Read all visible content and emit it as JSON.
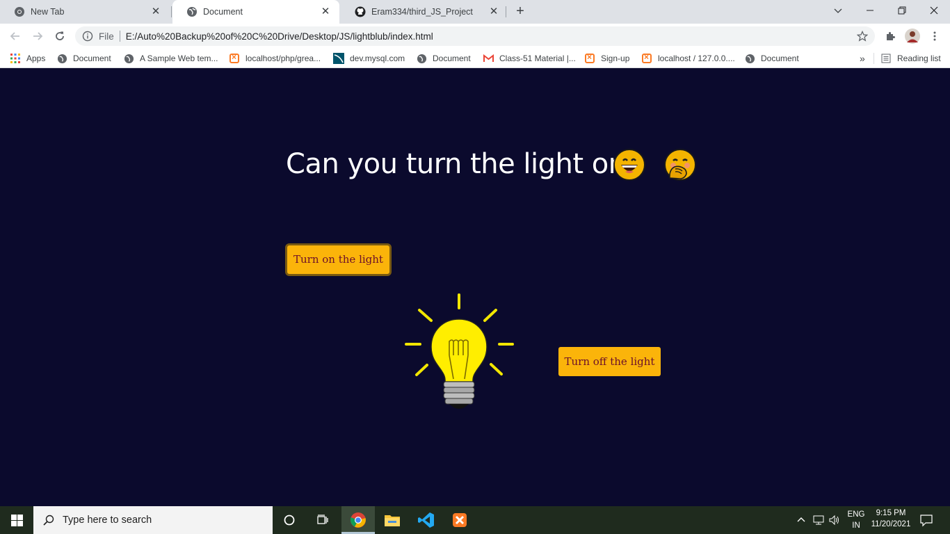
{
  "browser": {
    "tabs": [
      {
        "title": "New Tab",
        "active": false,
        "icon": "chrome-icon"
      },
      {
        "title": "Document",
        "active": true,
        "icon": "globe-icon"
      },
      {
        "title": "Eram334/third_JS_Project",
        "active": false,
        "icon": "github-icon"
      }
    ],
    "address": {
      "scheme": "File",
      "url": "E:/Auto%20Backup%20of%20C%20Drive/Desktop/JS/lightblub/index.html"
    },
    "bookmarks": [
      {
        "label": "Apps",
        "icon": "apps-grid-icon"
      },
      {
        "label": "Document",
        "icon": "globe-icon"
      },
      {
        "label": "A Sample Web tem...",
        "icon": "globe-icon"
      },
      {
        "label": "localhost/php/grea...",
        "icon": "xampp-icon"
      },
      {
        "label": "dev.mysql.com",
        "icon": "mysql-icon"
      },
      {
        "label": "Document",
        "icon": "globe-icon"
      },
      {
        "label": "Class-51 Material |...",
        "icon": "gmail-icon"
      },
      {
        "label": "Sign-up",
        "icon": "xampp-icon"
      },
      {
        "label": "localhost / 127.0.0....",
        "icon": "xampp-icon"
      },
      {
        "label": "Document",
        "icon": "globe-icon"
      }
    ],
    "more_label": "»",
    "reading_list": "Reading list"
  },
  "page": {
    "heading": "Can you turn the light on",
    "turn_on_label": "Turn on the light",
    "turn_off_label": "Turn off the light",
    "bulb_state": "on",
    "colors": {
      "background": "#0b0a2d",
      "button": "#fbb40a",
      "button_text": "#6b0f2a",
      "bulb": "#ffee00"
    }
  },
  "taskbar": {
    "search_placeholder": "Type here to search",
    "language_top": "ENG",
    "language_bottom": "IN",
    "time": "9:15 PM",
    "date": "11/20/2021"
  }
}
